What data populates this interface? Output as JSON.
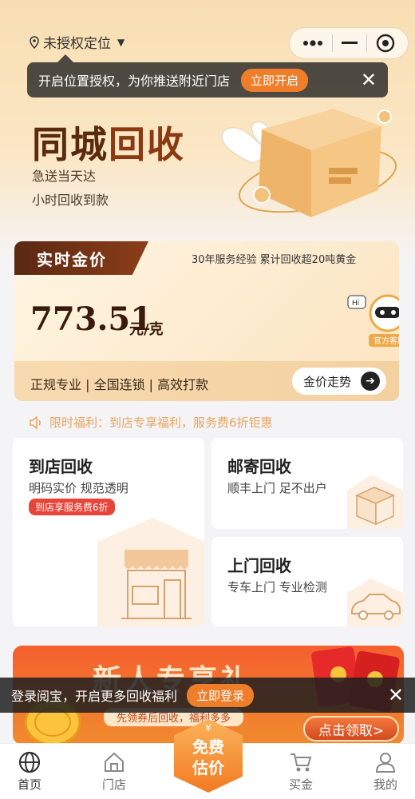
{
  "header": {
    "location_label": "未授权定位",
    "capsule_icons": [
      "more-dots-icon",
      "minimize-icon",
      "target-icon"
    ]
  },
  "location_tip": {
    "text": "开启位置授权，为你推送附近门店",
    "button": "立即开启",
    "close": "✕"
  },
  "hero": {
    "title_part1": "同城",
    "title_part2": "回收",
    "line1": "急送当天达",
    "line2": "小时回收到款"
  },
  "gold": {
    "tag": "实时金价",
    "experience": "30年服务经验  累计回收超20吨黄金",
    "price": "773.51",
    "unit": "元/克",
    "features": "正规专业 | 全国连锁 | 高效打款",
    "trend_button": "金价走势",
    "robot_hi": "Hi",
    "robot_label": "官方客服"
  },
  "notice": {
    "text": "限时福利：到店专享福利，服务费6折钜惠"
  },
  "services": [
    {
      "title": "到店回收",
      "desc": "明码实价 规范透明",
      "badge": "到店享服务费6折"
    },
    {
      "title": "邮寄回收",
      "desc": "顺丰上门 足不出户"
    },
    {
      "title": "上门回收",
      "desc": "专车上门 专业检测"
    }
  ],
  "banner": {
    "title": "新人专享礼",
    "sub": "先领券后回收，福利多多",
    "button": "点击领取>"
  },
  "login_bar": {
    "text": "登录阅宝，开启更多回收福利",
    "button": "立即登录",
    "close": "✕"
  },
  "tabbar": {
    "items": [
      {
        "label": "首页",
        "icon": "globe-icon"
      },
      {
        "label": "门店",
        "icon": "home-icon"
      },
      {
        "label": "买金",
        "icon": "cart-icon"
      },
      {
        "label": "我的",
        "icon": "user-icon"
      }
    ],
    "center_label_line1": "免费",
    "center_label_line2": "估价",
    "center_coin": "¥"
  },
  "colors": {
    "accent": "#f07d2a",
    "brand_dark": "#5a2812",
    "badge_red": "#e8453a"
  }
}
